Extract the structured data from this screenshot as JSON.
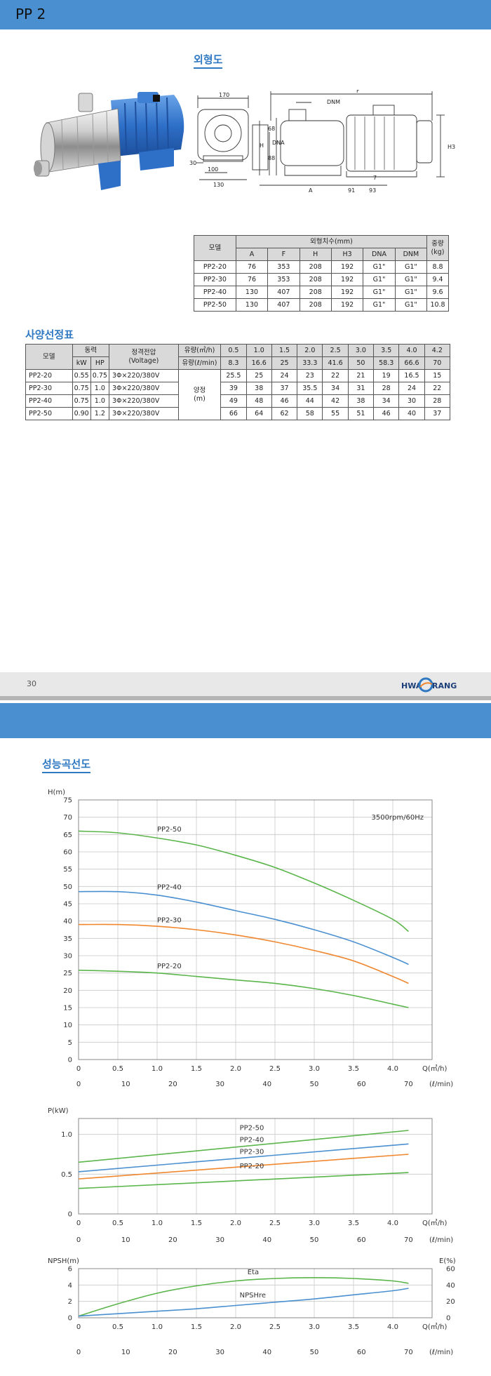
{
  "header": {
    "title": "PP 2"
  },
  "sections": {
    "outline": "외형도",
    "spec": "사양선정표",
    "curve": "성능곡선도"
  },
  "drawing_labels": [
    "170",
    "F",
    "DNM",
    "H3",
    "H",
    "68",
    "88",
    "DNA",
    "30",
    "100",
    "130",
    "A",
    "91",
    "7",
    "93"
  ],
  "dim_table": {
    "model_header": "모델",
    "group_header": "외형치수(mm)",
    "weight_header": [
      "중량",
      "(kg)"
    ],
    "columns": [
      "A",
      "F",
      "H",
      "H3",
      "DNA",
      "DNM"
    ],
    "rows": [
      {
        "model": "PP2-20",
        "cells": [
          "76",
          "353",
          "208",
          "192",
          "G1\"",
          "G1\""
        ],
        "weight": "8.8"
      },
      {
        "model": "PP2-30",
        "cells": [
          "76",
          "353",
          "208",
          "192",
          "G1\"",
          "G1\""
        ],
        "weight": "9.4"
      },
      {
        "model": "PP2-40",
        "cells": [
          "130",
          "407",
          "208",
          "192",
          "G1\"",
          "G1\""
        ],
        "weight": "9.6"
      },
      {
        "model": "PP2-50",
        "cells": [
          "130",
          "407",
          "208",
          "192",
          "G1\"",
          "G1\""
        ],
        "weight": "10.8"
      }
    ]
  },
  "spec_table": {
    "model_header": "모델",
    "power_header": "동력",
    "power_units": [
      "kW",
      "HP"
    ],
    "voltage_header": [
      "정격전압",
      "(Voltage)"
    ],
    "flow_m3h_label": "유량(㎥/h)",
    "flow_lmin_label": "유량(ℓ/min)",
    "flow_m3h": [
      "0.5",
      "1.0",
      "1.5",
      "2.0",
      "2.5",
      "3.0",
      "3.5",
      "4.0",
      "4.2"
    ],
    "flow_lmin": [
      "8.3",
      "16.6",
      "25",
      "33.3",
      "41.6",
      "50",
      "58.3",
      "66.6",
      "70"
    ],
    "head_label": [
      "양정",
      "(m)"
    ],
    "rows": [
      {
        "model": "PP2-20",
        "kw": "0.55",
        "hp": "0.75",
        "voltage": "3Φ×220/380V",
        "heads": [
          "25.5",
          "25",
          "24",
          "23",
          "22",
          "21",
          "19",
          "16.5",
          "15"
        ]
      },
      {
        "model": "PP2-30",
        "kw": "0.75",
        "hp": "1.0",
        "voltage": "3Φ×220/380V",
        "heads": [
          "39",
          "38",
          "37",
          "35.5",
          "34",
          "31",
          "28",
          "24",
          "22"
        ]
      },
      {
        "model": "PP2-40",
        "kw": "0.75",
        "hp": "1.0",
        "voltage": "3Φ×220/380V",
        "heads": [
          "49",
          "48",
          "46",
          "44",
          "42",
          "38",
          "34",
          "30",
          "28"
        ]
      },
      {
        "model": "PP2-50",
        "kw": "0.90",
        "hp": "1.2",
        "voltage": "3Φ×220/380V",
        "heads": [
          "66",
          "64",
          "62",
          "58",
          "55",
          "51",
          "46",
          "40",
          "37"
        ]
      }
    ]
  },
  "footer": {
    "page": "30",
    "brand_left": "HWA",
    "brand_right": "RANG"
  },
  "chart_data": [
    {
      "type": "line",
      "ylabel": "H(m)",
      "xlabel": "Q(㎥/h)",
      "x2label": "(ℓ/min)",
      "annotation": "3500rpm/60Hz",
      "xlim": [
        0,
        4.5
      ],
      "ylim": [
        0,
        75
      ],
      "xticks": [
        "0",
        "0.5",
        "1.0",
        "1.5",
        "2.0",
        "2.5",
        "3.0",
        "3.5",
        "4.0"
      ],
      "yticks": [
        "0",
        "5",
        "10",
        "15",
        "20",
        "25",
        "30",
        "35",
        "40",
        "45",
        "50",
        "55",
        "60",
        "65",
        "70",
        "75"
      ],
      "x2ticks": [
        "0",
        "10",
        "20",
        "30",
        "40",
        "50",
        "60",
        "70"
      ],
      "grid": true,
      "x": [
        0,
        0.5,
        1.0,
        1.5,
        2.0,
        2.5,
        3.0,
        3.5,
        4.0,
        4.2
      ],
      "series": [
        {
          "name": "PP2-50",
          "color": "#5ab54a",
          "values": [
            66,
            65.5,
            64,
            62,
            59,
            55.5,
            51,
            46,
            40.5,
            37
          ]
        },
        {
          "name": "PP2-40",
          "color": "#4a8fd0",
          "values": [
            48.5,
            48.5,
            47.5,
            45.5,
            43,
            40.5,
            37.5,
            34,
            29.5,
            27.5
          ]
        },
        {
          "name": "PP2-30",
          "color": "#f0872f",
          "values": [
            39,
            39,
            38.5,
            37.5,
            36,
            34,
            31.5,
            28.5,
            24,
            22
          ]
        },
        {
          "name": "PP2-20",
          "color": "#5ab54a",
          "values": [
            25.8,
            25.5,
            25,
            24,
            23,
            22,
            20.5,
            18.5,
            16,
            15
          ]
        }
      ]
    },
    {
      "type": "line",
      "ylabel": "P(kW)",
      "xlabel": "Q(㎥/h)",
      "x2label": "(ℓ/min)",
      "xlim": [
        0,
        4.5
      ],
      "ylim": [
        0,
        1.2
      ],
      "xticks": [
        "0",
        "0.5",
        "1.0",
        "1.5",
        "2.0",
        "2.5",
        "3.0",
        "3.5",
        "4.0"
      ],
      "yticks": [
        "0",
        "0.5",
        "1.0"
      ],
      "x2ticks": [
        "0",
        "10",
        "20",
        "30",
        "40",
        "50",
        "60",
        "70"
      ],
      "grid": true,
      "x": [
        0,
        4.2
      ],
      "series": [
        {
          "name": "PP2-50",
          "color": "#5ab54a",
          "values": [
            0.65,
            1.05
          ]
        },
        {
          "name": "PP2-40",
          "color": "#4a8fd0",
          "values": [
            0.53,
            0.88
          ]
        },
        {
          "name": "PP2-30",
          "color": "#f0872f",
          "values": [
            0.44,
            0.75
          ]
        },
        {
          "name": "PP2-20",
          "color": "#5ab54a",
          "values": [
            0.32,
            0.52
          ]
        }
      ]
    },
    {
      "type": "line",
      "ylabel": "NPSH(m)",
      "y2label": "E(%)",
      "xlabel": "Q(㎥/h)",
      "x2label": "(ℓ/min)",
      "xlim": [
        0,
        4.5
      ],
      "ylim": [
        0,
        6
      ],
      "y2lim": [
        0,
        60
      ],
      "xticks": [
        "0",
        "0.5",
        "1.0",
        "1.5",
        "2.0",
        "2.5",
        "3.0",
        "3.5",
        "4.0"
      ],
      "yticks": [
        "0",
        "2",
        "4",
        "6"
      ],
      "y2ticks": [
        "0",
        "20",
        "40",
        "60"
      ],
      "x2ticks": [
        "0",
        "10",
        "20",
        "30",
        "40",
        "50",
        "60",
        "70"
      ],
      "grid": true,
      "x": [
        0,
        0.5,
        1.0,
        1.5,
        2.0,
        2.5,
        3.0,
        3.5,
        4.0,
        4.2
      ],
      "series": [
        {
          "name": "Eta",
          "axis": "right",
          "color": "#5ab54a",
          "values": [
            2,
            17,
            30,
            39,
            45,
            48,
            49,
            48,
            45,
            42
          ]
        },
        {
          "name": "NPSHre",
          "axis": "left",
          "color": "#4a8fd0",
          "values": [
            0.2,
            0.5,
            0.8,
            1.1,
            1.5,
            1.9,
            2.3,
            2.8,
            3.3,
            3.6
          ]
        }
      ]
    }
  ]
}
